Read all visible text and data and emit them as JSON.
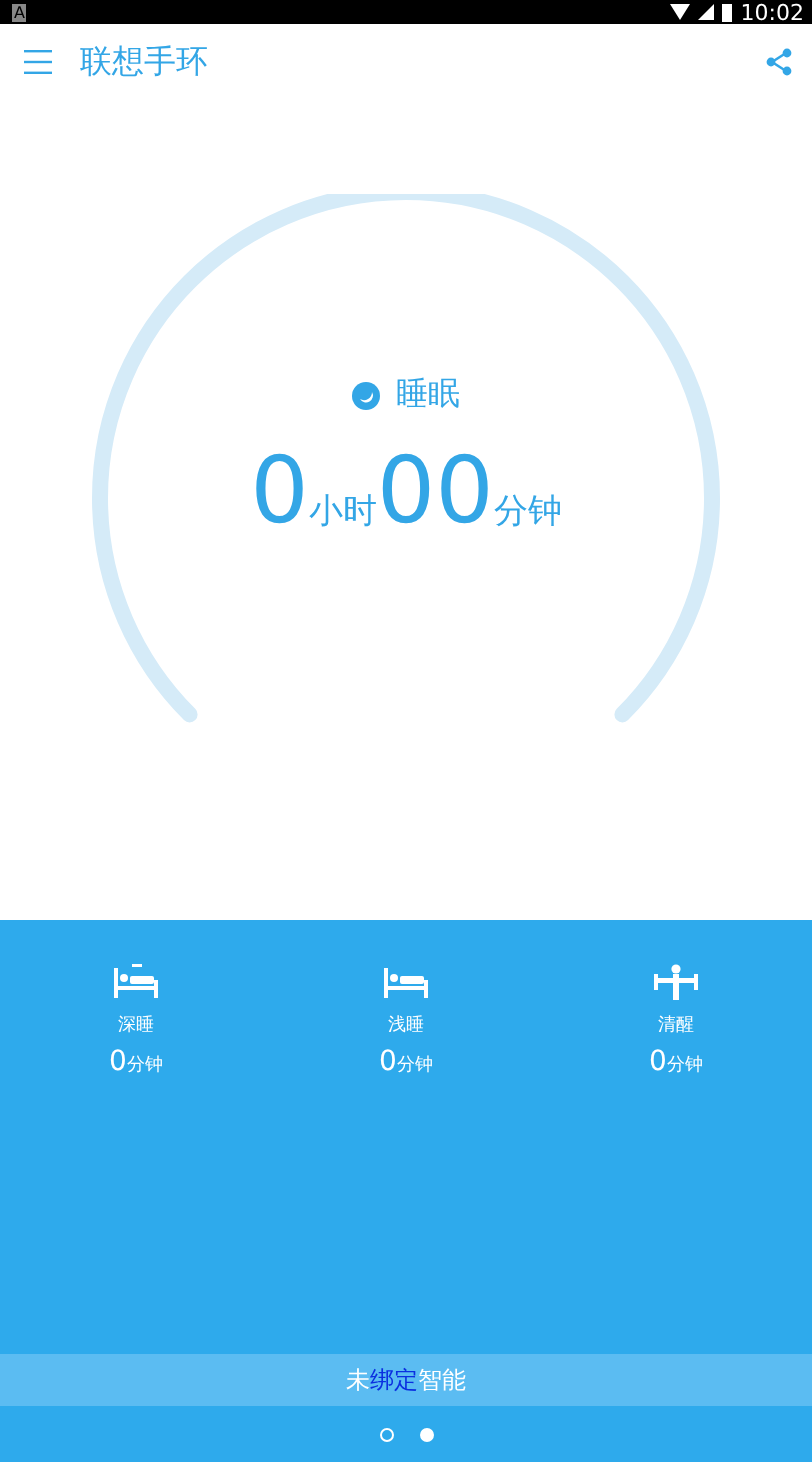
{
  "status_bar": {
    "notification": "A",
    "time": "10:02"
  },
  "app_bar": {
    "title": "联想手环"
  },
  "sleep_gauge": {
    "label": "睡眠",
    "hours": "0",
    "hours_unit": "小时",
    "minutes": "00",
    "minutes_unit": "分钟"
  },
  "stages": [
    {
      "kind": "deep",
      "label": "深睡",
      "value": "0",
      "unit": "分钟"
    },
    {
      "kind": "light",
      "label": "浅睡",
      "value": "0",
      "unit": "分钟"
    },
    {
      "kind": "awake",
      "label": "清醒",
      "value": "0",
      "unit": "分钟"
    }
  ],
  "banner": {
    "parts": [
      {
        "text": "未",
        "highlight": false
      },
      {
        "text": "绑定",
        "highlight": true
      },
      {
        "text": "智能",
        "highlight": false
      }
    ]
  },
  "pager": [
    {
      "selected": false
    },
    {
      "selected": true
    }
  ]
}
